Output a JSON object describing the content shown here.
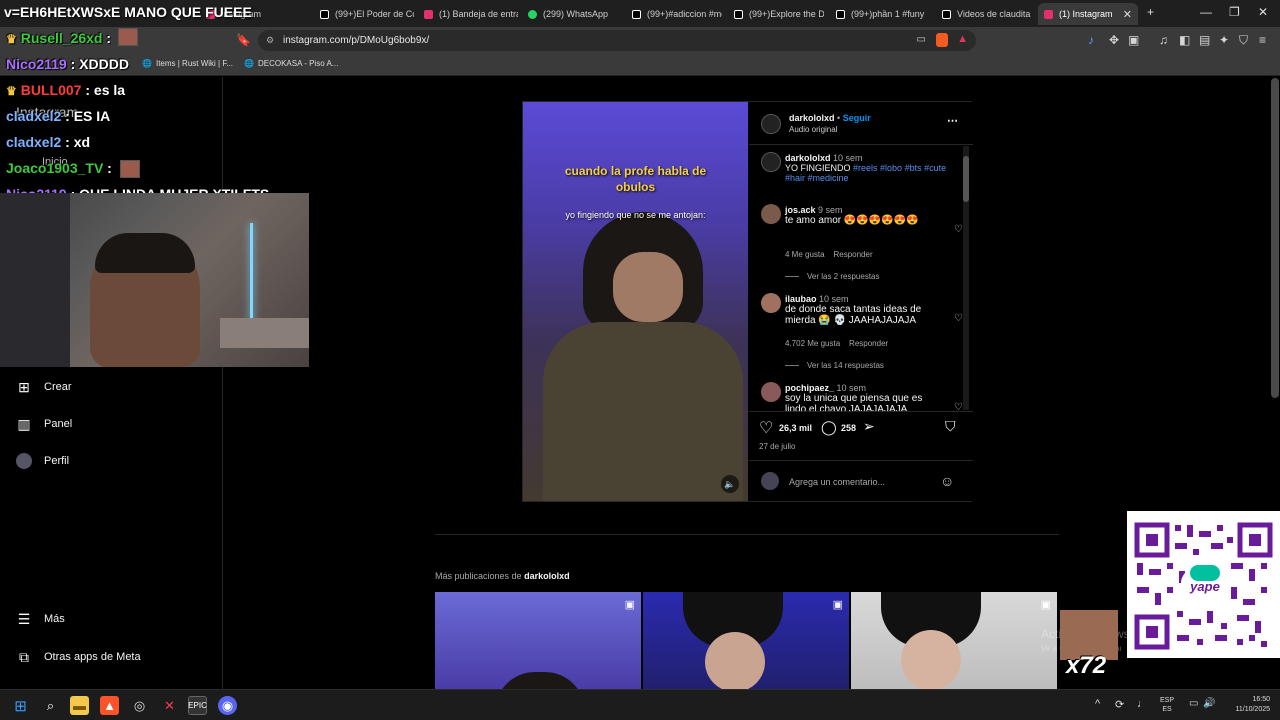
{
  "browser": {
    "tabs": [
      {
        "label": "Instagram",
        "color": "#e1306c"
      },
      {
        "label": "(99+)El Poder de Co",
        "color": "#ffffff"
      },
      {
        "label": "(1) Bandeja de entra",
        "color": "#e1306c"
      },
      {
        "label": "(299) WhatsApp",
        "color": "#25d366"
      },
      {
        "label": "(99+)#adiccion #me",
        "color": "#ffffff"
      },
      {
        "label": "(99+)Explore the De",
        "color": "#ffffff"
      },
      {
        "label": "(99+)phần 1 #funy",
        "color": "#ffffff"
      },
      {
        "label": "Videos de claudita",
        "color": "#ffffff"
      },
      {
        "label": "(1) Instagram",
        "color": "#e1306c"
      }
    ],
    "url": "instagram.com/p/DMoUg6bob9x/",
    "bookmarks": [
      "Items | Rust Wiki | F...",
      "DECOKASA - Piso A..."
    ]
  },
  "sidebar": {
    "items": [
      {
        "label": "Crear",
        "icon": "plus-square-icon"
      },
      {
        "label": "Panel",
        "icon": "chart-icon"
      },
      {
        "label": "Perfil",
        "icon": "avatar"
      },
      {
        "label": "Más",
        "icon": "menu-icon"
      },
      {
        "label": "Otras apps de Meta",
        "icon": "apps-icon"
      }
    ],
    "ghost_items": [
      "Instagram",
      "Inicio"
    ]
  },
  "stream": {
    "title": "v=EH6HEtXWSxE MANO QUE FUEEE",
    "chat": [
      {
        "user": "Rusell_26xd",
        "msg": "",
        "color": "#3ec93e",
        "crown": true
      },
      {
        "user": "Nico2119",
        "msg": "XDDDD",
        "color": "#a970ff",
        "crown": false
      },
      {
        "user": "BULL007",
        "msg": "es la",
        "color": "#ff3b3b",
        "crown": true
      },
      {
        "user": "cladxel2",
        "msg": "ES IA",
        "color": "#7fb2ff",
        "crown": false
      },
      {
        "user": "cladxel2",
        "msg": "xd",
        "color": "#7fb2ff",
        "crown": false
      },
      {
        "user": "Joaco1903_TV",
        "msg": "",
        "color": "#3ec93e",
        "crown": false
      },
      {
        "user": "Nico2119",
        "msg": "QUE LINDA MUJER XTILFTS",
        "color": "#a970ff",
        "crown": false
      }
    ],
    "overlay_count": "x72"
  },
  "post": {
    "username": "darkololxd",
    "follow": "Seguir",
    "audio": "Audio original",
    "video_caption": "cuando la profe habla de obulos",
    "video_subcaption": "yo fingiendo que no se me antojan:",
    "caption_user": "darkololxd",
    "caption_time": "10 sem",
    "caption_text": "YO FINGIENDO",
    "caption_tags": "#reels #lobo #bts #cute #hair #medicine",
    "comments": [
      {
        "user": "jos.ack",
        "time": "9 sem",
        "text": "te amo amor 😍😍😍😍😍😍",
        "likes": "4 Me gusta",
        "reply": "Responder",
        "replies": "Ver las 2 respuestas"
      },
      {
        "user": "ilaubao",
        "time": "10 sem",
        "text": "de donde saca tantas ideas de mierda 😭 💀 JAAHAJAJAJA",
        "likes": "4.702 Me gusta",
        "reply": "Responder",
        "replies": "Ver las 14 respuestas"
      },
      {
        "user": "pochipaez_",
        "time": "10 sem",
        "text": "soy la unica que piensa que es lindo el chavo JAJAJAJAJA",
        "likes": "",
        "reply": "",
        "replies": ""
      }
    ],
    "like_count": "26,3 mil",
    "comment_count": "258",
    "date": "27 de julio",
    "add_comment_placeholder": "Agrega un comentario..."
  },
  "more_posts": {
    "heading_prefix": "Más publicaciones de",
    "heading_user": "darkololxd"
  },
  "windows": {
    "activate_text": "Activar Windows",
    "activate_sub": "Ve a Configuración para activar Windows.",
    "lang": "ESP",
    "lang2": "ES",
    "time": "16:50",
    "date": "11/10/2025"
  },
  "qr": {
    "brand": "yape"
  }
}
